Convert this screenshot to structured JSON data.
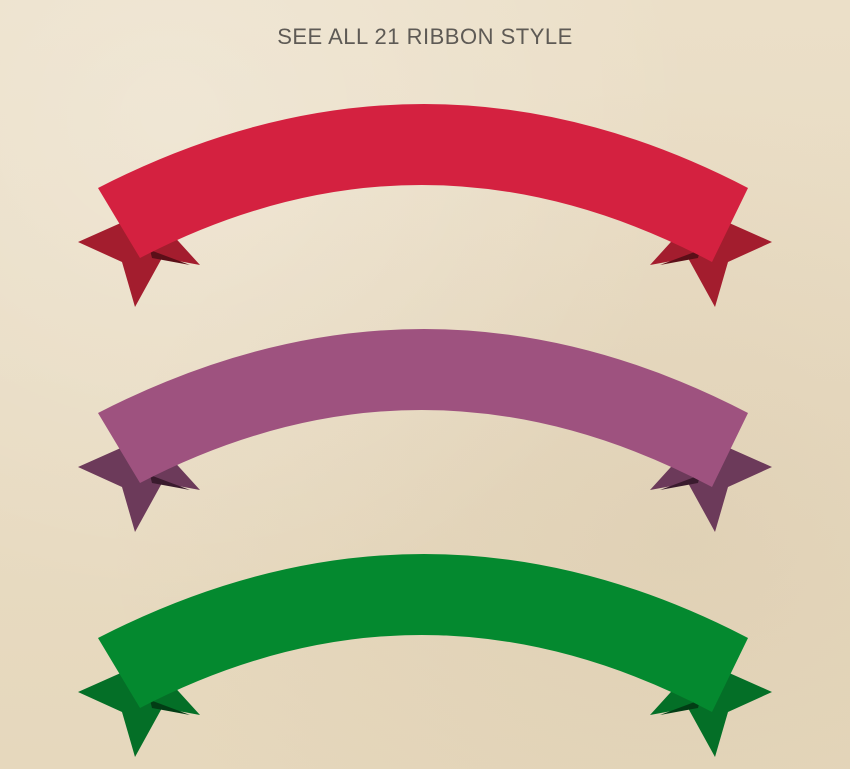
{
  "header": {
    "title": "SEE ALL 21 RIBBON STYLE"
  },
  "ribbons": [
    {
      "name": "red-ribbon",
      "band": "#d42140",
      "tail": "#a31d2e",
      "fold": "#5b0f18"
    },
    {
      "name": "purple-ribbon",
      "band": "#9e527f",
      "tail": "#6c3a5a",
      "fold": "#3a1b2e"
    },
    {
      "name": "green-ribbon",
      "band": "#04892f",
      "tail": "#046f27",
      "fold": "#023d15"
    }
  ]
}
